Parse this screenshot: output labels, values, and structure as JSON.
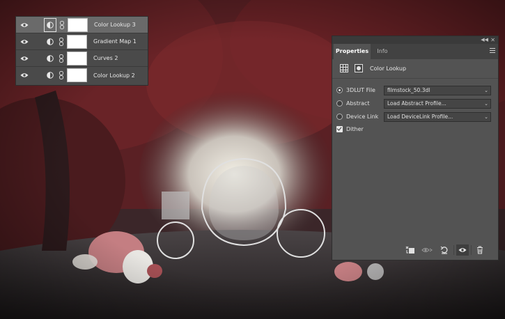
{
  "layers_panel": {
    "layers": [
      {
        "name": "Color Lookup 3",
        "selected": true,
        "icon": "adjustment-circle-icon"
      },
      {
        "name": "Gradient Map 1",
        "selected": false,
        "icon": "adjustment-circle-icon"
      },
      {
        "name": "Curves 2",
        "selected": false,
        "icon": "adjustment-circle-icon"
      },
      {
        "name": "Color Lookup 2",
        "selected": false,
        "icon": "adjustment-circle-icon"
      }
    ]
  },
  "properties_panel": {
    "tabs": [
      {
        "label": "Properties",
        "active": true
      },
      {
        "label": "Info",
        "active": false
      }
    ],
    "title": "Color Lookup",
    "options": [
      {
        "label": "3DLUT File",
        "selected": true,
        "value": "filmstock_50.3dl"
      },
      {
        "label": "Abstract",
        "selected": false,
        "value": "Load Abstract Profile..."
      },
      {
        "label": "Device Link",
        "selected": false,
        "value": "Load DeviceLink Profile..."
      }
    ],
    "dither": {
      "label": "Dither",
      "checked": true
    },
    "bottom_icons": [
      "clip-to-layer-icon",
      "view-previous-state-icon",
      "reset-icon",
      "visibility-eye-icon",
      "trash-icon"
    ]
  },
  "colors": {
    "panel_bg": "#535353",
    "layers_bg": "#4a4a4a",
    "selected_row": "#6a6a6a"
  }
}
